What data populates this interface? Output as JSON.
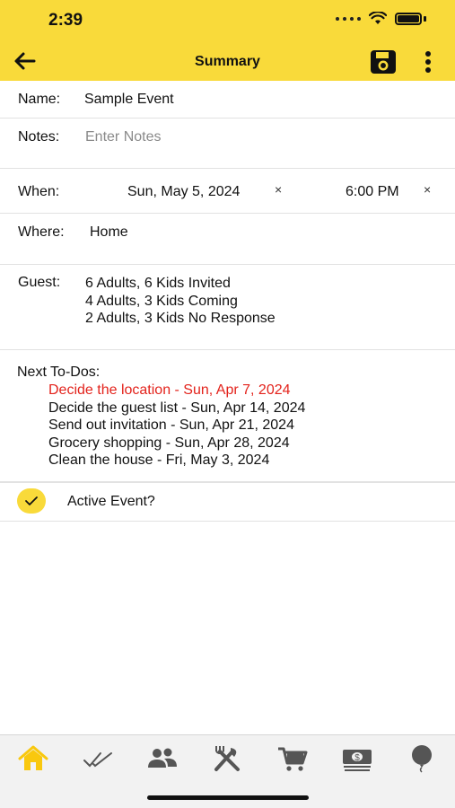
{
  "status": {
    "time": "2:39"
  },
  "nav": {
    "title": "Summary"
  },
  "form": {
    "name_label": "Name:",
    "name_value": "Sample Event",
    "notes_label": "Notes:",
    "notes_placeholder": "Enter Notes",
    "when_label": "When:",
    "when_date": "Sun, May 5, 2024",
    "when_time": "6:00 PM",
    "clear_glyph": "×",
    "where_label": "Where:",
    "where_value": "Home",
    "guest_label": "Guest:",
    "guest_lines": [
      "6 Adults, 6 Kids Invited",
      "4 Adults, 3 Kids Coming",
      "2 Adults, 3 Kids No Response"
    ],
    "todos_label": "Next To-Dos:",
    "todos": [
      {
        "text": "Decide the location - Sun, Apr 7, 2024",
        "overdue": true
      },
      {
        "text": "Decide the guest list - Sun, Apr 14, 2024",
        "overdue": false
      },
      {
        "text": "Send out invitation - Sun, Apr 21, 2024",
        "overdue": false
      },
      {
        "text": "Grocery shopping - Sun, Apr 28, 2024",
        "overdue": false
      },
      {
        "text": "Clean the house - Fri, May 3, 2024",
        "overdue": false
      }
    ],
    "active_label": "Active Event?",
    "active_checked": true
  },
  "tabs": [
    {
      "name": "home",
      "icon": "home-icon",
      "active": true
    },
    {
      "name": "todos",
      "icon": "double-check-icon",
      "active": false
    },
    {
      "name": "guests",
      "icon": "people-icon",
      "active": false
    },
    {
      "name": "menu",
      "icon": "fork-knife-icon",
      "active": false
    },
    {
      "name": "shopping",
      "icon": "cart-icon",
      "active": false
    },
    {
      "name": "budget",
      "icon": "money-icon",
      "active": false
    },
    {
      "name": "ideas",
      "icon": "balloon-icon",
      "active": false
    }
  ],
  "colors": {
    "accent": "#f9da3a",
    "overdue": "#e3231c",
    "tab_active": "#f9c80e",
    "tab_inactive": "#555555"
  }
}
